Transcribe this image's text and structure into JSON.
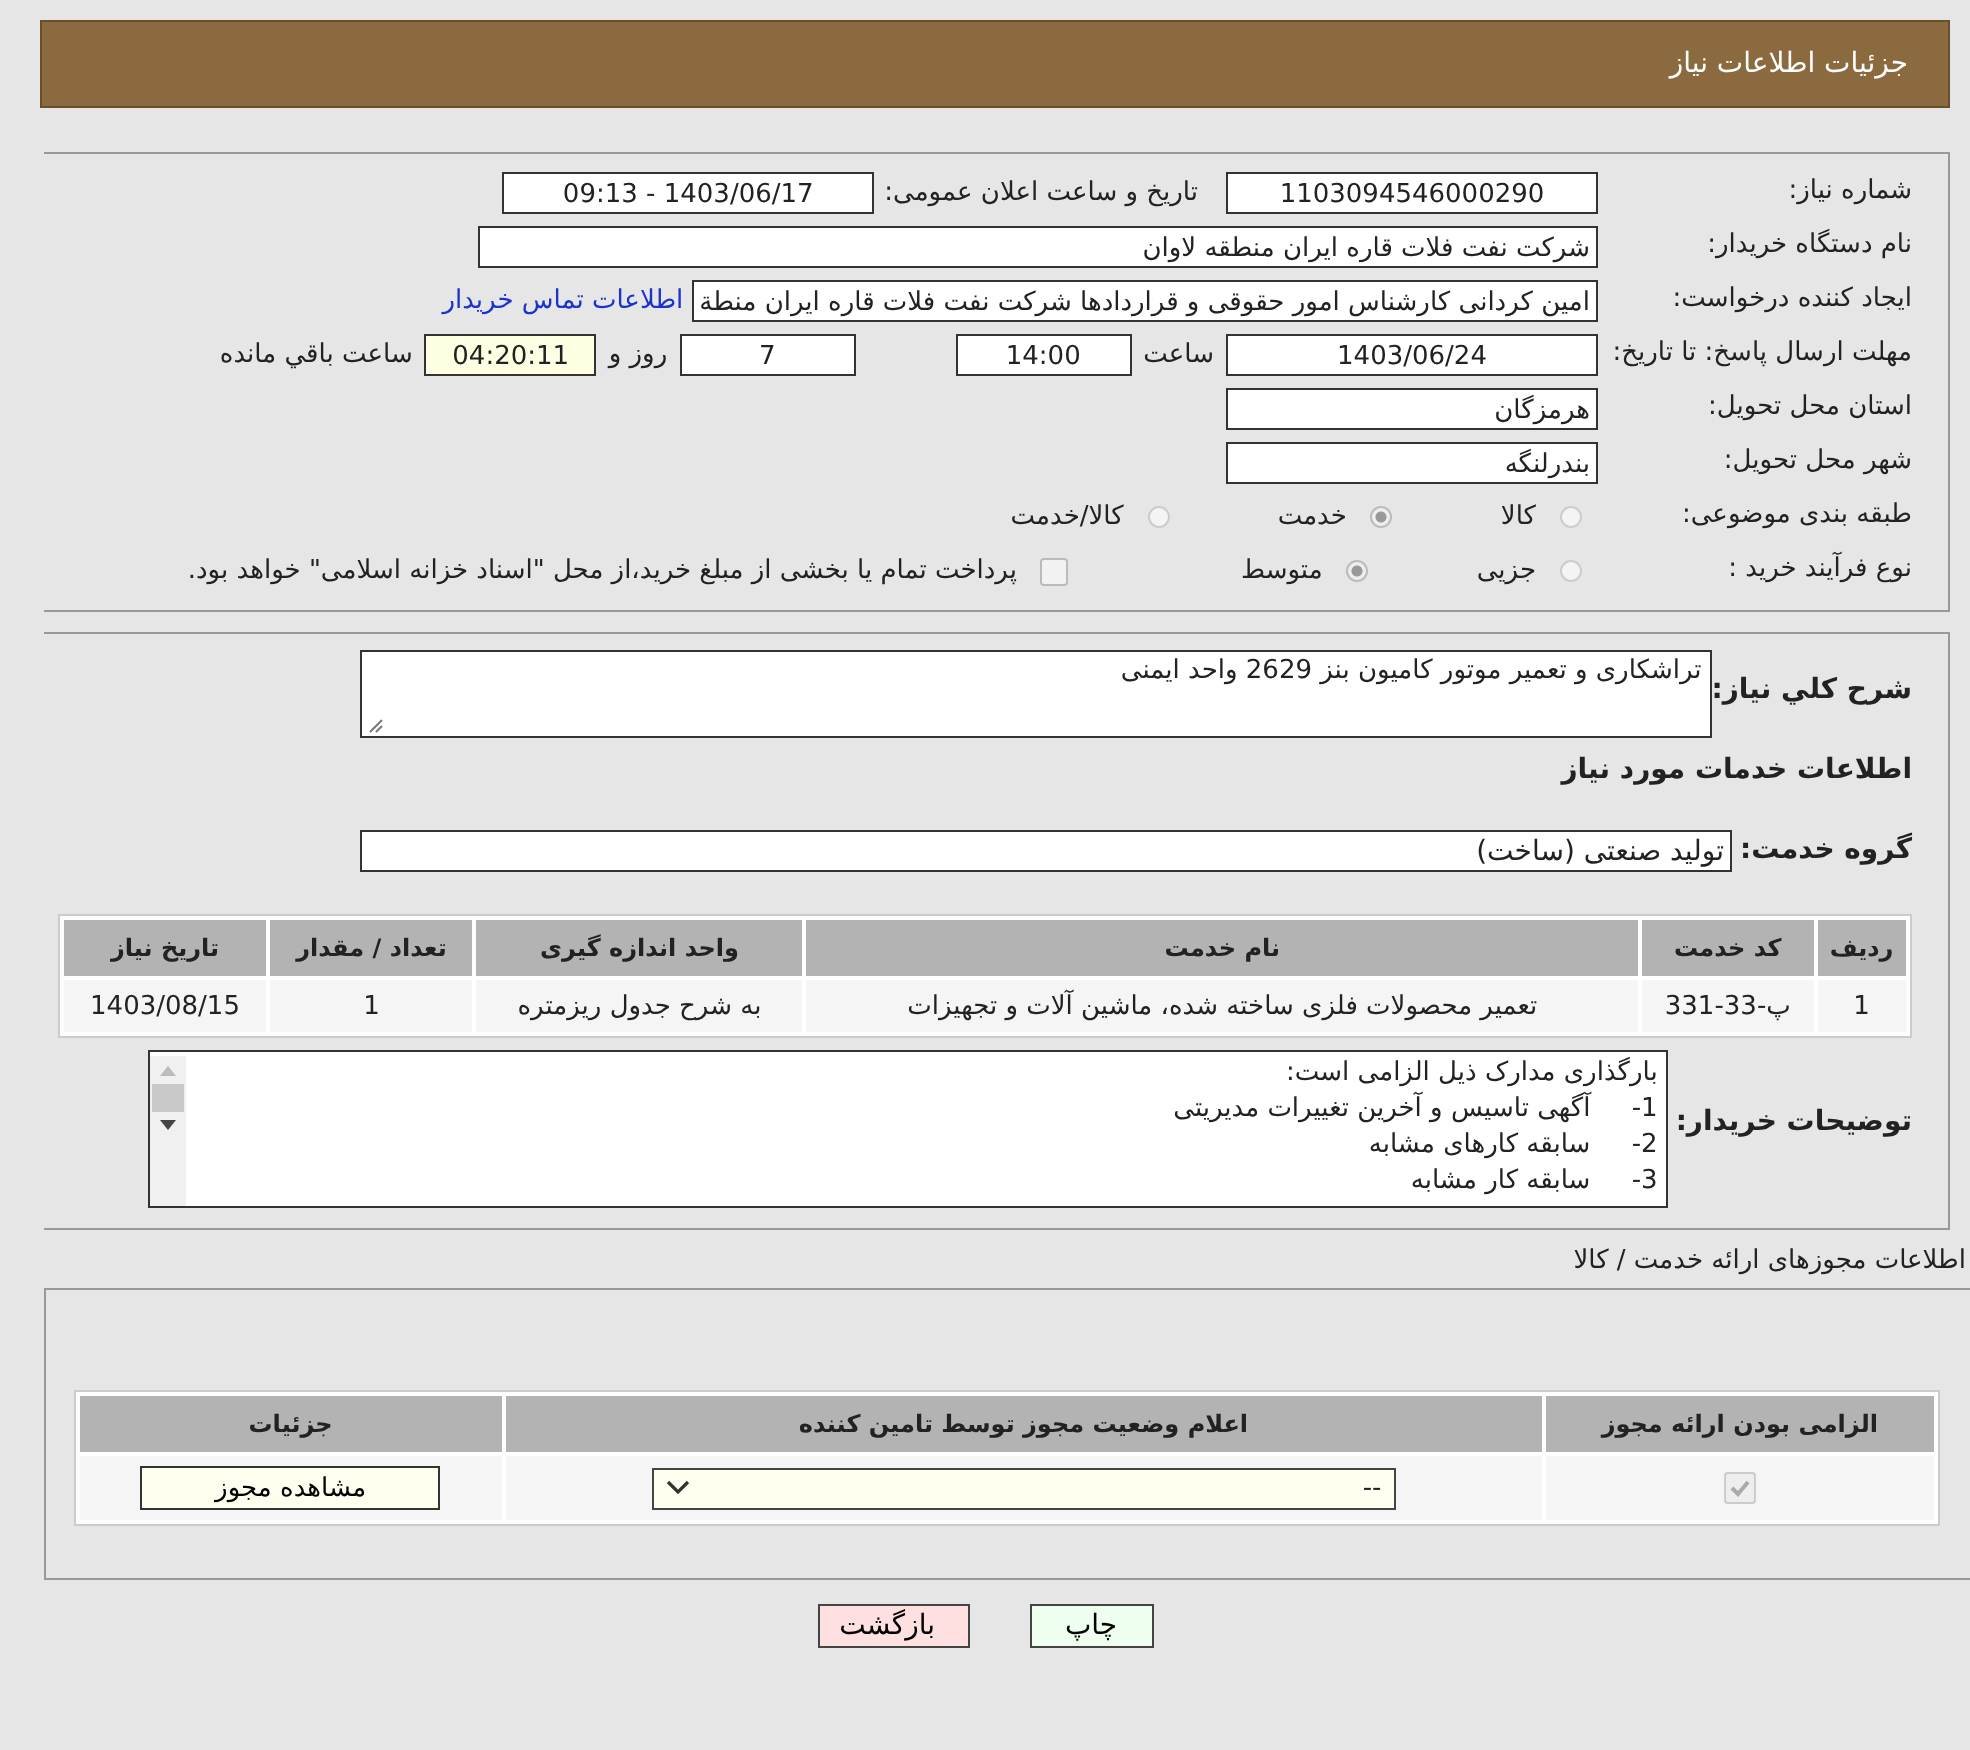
{
  "header": {
    "title": "جزئیات اطلاعات نیاز"
  },
  "need_number": {
    "label": "شماره نیاز:",
    "value": "1103094546000290"
  },
  "announce": {
    "label": "تاریخ و ساعت اعلان عمومی:",
    "value": "1403/06/17 - 09:13"
  },
  "buyer_org": {
    "label": "نام دستگاه خریدار:",
    "value": "شرکت نفت فلات قاره ایران منطقه لاوان"
  },
  "requester": {
    "label": "ایجاد کننده درخواست:",
    "value": "امین کردانی کارشناس امور حقوقی و قراردادها شرکت نفت فلات قاره ایران منطة",
    "link": "اطلاعات تماس خریدار"
  },
  "deadline": {
    "label": "مهلت ارسال پاسخ: تا تاریخ:",
    "date": "1403/06/24",
    "time_label": "ساعت",
    "time": "14:00",
    "days": "7",
    "days_label": "روز و",
    "remaining": "04:20:11",
    "remaining_label": "ساعت باقي مانده"
  },
  "province": {
    "label": "استان محل تحویل:",
    "value": "هرمزگان"
  },
  "city": {
    "label": "شهر محل تحویل:",
    "value": "بندرلنگه"
  },
  "category": {
    "label": "طبقه بندی موضوعی:",
    "options": [
      {
        "label": "کالا",
        "selected": false
      },
      {
        "label": "خدمت",
        "selected": true
      },
      {
        "label": "کالا/خدمت",
        "selected": false
      }
    ]
  },
  "purchase_process": {
    "label": "نوع فرآیند خرید :",
    "options": [
      {
        "label": "جزیی",
        "selected": false
      },
      {
        "label": "متوسط",
        "selected": true
      }
    ],
    "treasury": {
      "label": "پرداخت تمام یا بخشی از مبلغ خرید،از محل \"اسناد خزانه اسلامی\" خواهد بود.",
      "checked": false
    }
  },
  "description": {
    "label": "شرح کلي نیاز:",
    "value": "تراشکاری و تعمیر موتور کامیون بنز 2629 واحد ایمنی"
  },
  "services_heading": "اطلاعات خدمات مورد نیاز",
  "service_group": {
    "label": "گروه خدمت:",
    "value": "تولید صنعتی (ساخت)"
  },
  "services_table": {
    "columns": [
      "ردیف",
      "کد خدمت",
      "نام خدمت",
      "واحد اندازه گیری",
      "تعداد / مقدار",
      "تاریخ نیاز"
    ],
    "rows": [
      [
        "1",
        "پ-33-331",
        "تعمیر محصولات فلزی ساخته شده، ماشین آلات و تجهیزات",
        "به شرح جدول ریزمتره",
        "1",
        "1403/08/15"
      ]
    ]
  },
  "buyer_notes": {
    "label": "توضیحات خریدار:",
    "lines": [
      "بارگذاری مدارک ذیل الزامی است:",
      "1-     آگهی تاسیس و آخرین تغییرات مدیریتی",
      "2-     سابقه کارهای مشابه",
      "3-     سابقه کار مشابه"
    ]
  },
  "licenses_heading": "اطلاعات مجوزهای ارائه خدمت / کالا",
  "licenses_table": {
    "columns": [
      "الزامی بودن ارائه مجوز",
      "اعلام وضعیت مجوز توسط تامین کننده",
      "جزئیات"
    ],
    "rows": [
      {
        "required": true,
        "status": "--",
        "details_button": "مشاهده مجوز"
      }
    ]
  },
  "buttons": [
    {
      "kind": "print",
      "label": "چاپ"
    },
    {
      "kind": "back",
      "label": "بازگشت"
    }
  ]
}
